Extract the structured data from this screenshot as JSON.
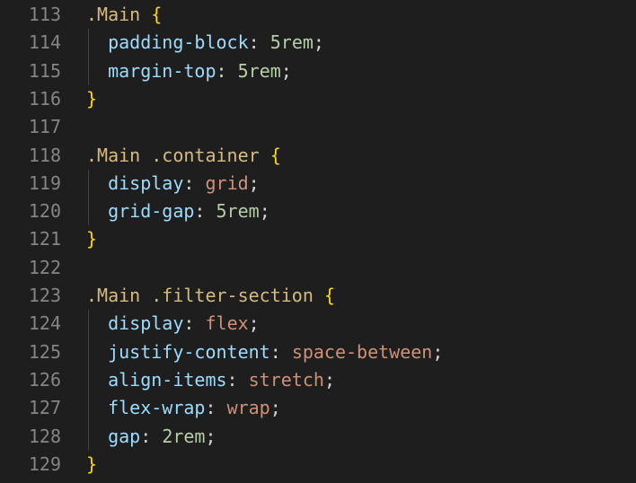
{
  "colors": {
    "background": "#1e1e1e",
    "line_number": "#858585",
    "selector": "#d7ba7d",
    "brace": "#ffd700",
    "property": "#9cdcfe",
    "punctuation": "#d4d4d4",
    "number": "#b5cea8",
    "value": "#ce9178",
    "indent_guide": "#404040"
  },
  "lines": [
    {
      "num": "113",
      "tokens": [
        {
          "t": "sel",
          "text": ".Main"
        },
        {
          "t": "punct",
          "text": " "
        },
        {
          "t": "brace",
          "text": "{"
        }
      ]
    },
    {
      "num": "114",
      "tokens": [
        {
          "t": "punct",
          "text": "  "
        },
        {
          "t": "prop",
          "text": "padding-block"
        },
        {
          "t": "punct",
          "text": ": "
        },
        {
          "t": "num",
          "text": "5rem"
        },
        {
          "t": "punct",
          "text": ";"
        }
      ]
    },
    {
      "num": "115",
      "tokens": [
        {
          "t": "punct",
          "text": "  "
        },
        {
          "t": "prop",
          "text": "margin-top"
        },
        {
          "t": "punct",
          "text": ": "
        },
        {
          "t": "num",
          "text": "5rem"
        },
        {
          "t": "punct",
          "text": ";"
        }
      ]
    },
    {
      "num": "116",
      "tokens": [
        {
          "t": "brace",
          "text": "}"
        }
      ]
    },
    {
      "num": "117",
      "tokens": []
    },
    {
      "num": "118",
      "tokens": [
        {
          "t": "sel",
          "text": ".Main .container"
        },
        {
          "t": "punct",
          "text": " "
        },
        {
          "t": "brace",
          "text": "{"
        }
      ]
    },
    {
      "num": "119",
      "tokens": [
        {
          "t": "punct",
          "text": "  "
        },
        {
          "t": "prop",
          "text": "display"
        },
        {
          "t": "punct",
          "text": ": "
        },
        {
          "t": "val",
          "text": "grid"
        },
        {
          "t": "punct",
          "text": ";"
        }
      ]
    },
    {
      "num": "120",
      "tokens": [
        {
          "t": "punct",
          "text": "  "
        },
        {
          "t": "prop",
          "text": "grid-gap"
        },
        {
          "t": "punct",
          "text": ": "
        },
        {
          "t": "num",
          "text": "5rem"
        },
        {
          "t": "punct",
          "text": ";"
        }
      ]
    },
    {
      "num": "121",
      "tokens": [
        {
          "t": "brace",
          "text": "}"
        }
      ]
    },
    {
      "num": "122",
      "tokens": []
    },
    {
      "num": "123",
      "tokens": [
        {
          "t": "sel",
          "text": ".Main .filter-section"
        },
        {
          "t": "punct",
          "text": " "
        },
        {
          "t": "brace",
          "text": "{"
        }
      ]
    },
    {
      "num": "124",
      "tokens": [
        {
          "t": "punct",
          "text": "  "
        },
        {
          "t": "prop",
          "text": "display"
        },
        {
          "t": "punct",
          "text": ": "
        },
        {
          "t": "val",
          "text": "flex"
        },
        {
          "t": "punct",
          "text": ";"
        }
      ]
    },
    {
      "num": "125",
      "tokens": [
        {
          "t": "punct",
          "text": "  "
        },
        {
          "t": "prop",
          "text": "justify-content"
        },
        {
          "t": "punct",
          "text": ": "
        },
        {
          "t": "val",
          "text": "space-between"
        },
        {
          "t": "punct",
          "text": ";"
        }
      ]
    },
    {
      "num": "126",
      "tokens": [
        {
          "t": "punct",
          "text": "  "
        },
        {
          "t": "prop",
          "text": "align-items"
        },
        {
          "t": "punct",
          "text": ": "
        },
        {
          "t": "val",
          "text": "stretch"
        },
        {
          "t": "punct",
          "text": ";"
        }
      ]
    },
    {
      "num": "127",
      "tokens": [
        {
          "t": "punct",
          "text": "  "
        },
        {
          "t": "prop",
          "text": "flex-wrap"
        },
        {
          "t": "punct",
          "text": ": "
        },
        {
          "t": "val",
          "text": "wrap"
        },
        {
          "t": "punct",
          "text": ";"
        }
      ]
    },
    {
      "num": "128",
      "tokens": [
        {
          "t": "punct",
          "text": "  "
        },
        {
          "t": "prop",
          "text": "gap"
        },
        {
          "t": "punct",
          "text": ": "
        },
        {
          "t": "num",
          "text": "2rem"
        },
        {
          "t": "punct",
          "text": ";"
        }
      ]
    },
    {
      "num": "129",
      "tokens": [
        {
          "t": "brace",
          "text": "}"
        }
      ]
    }
  ]
}
